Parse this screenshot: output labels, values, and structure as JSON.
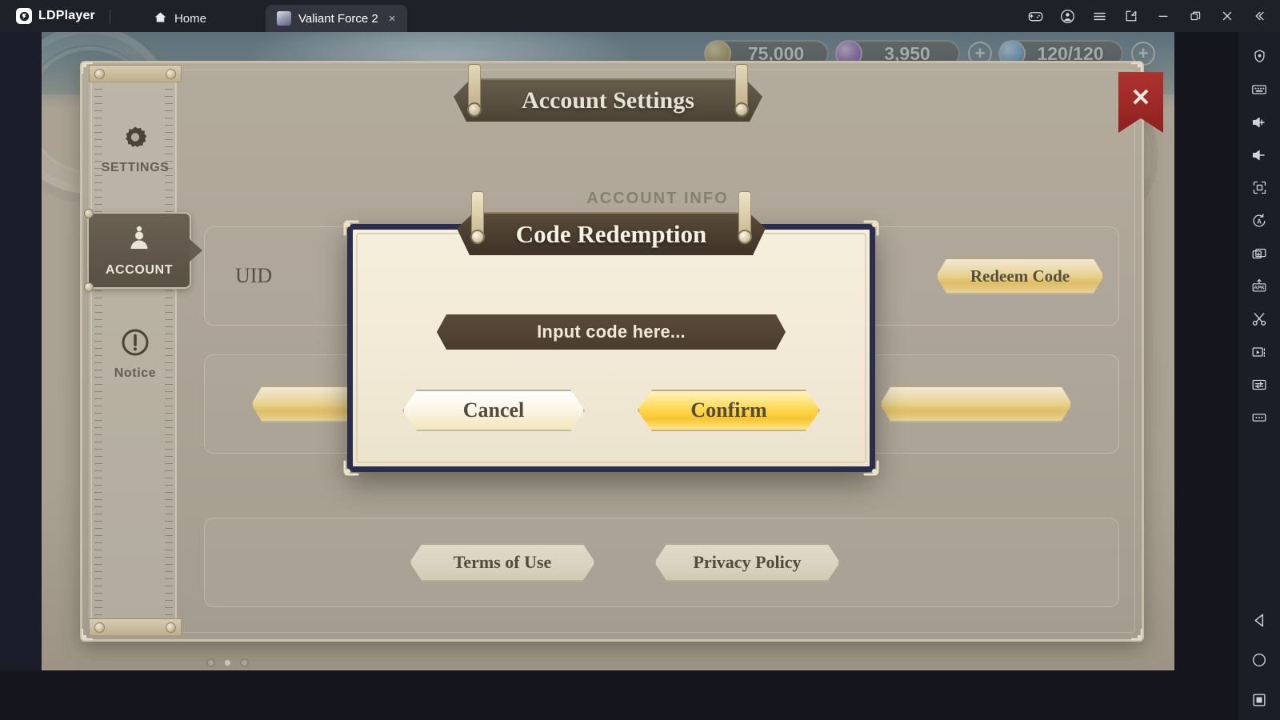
{
  "titlebar": {
    "brand": "LDPlayer",
    "brand_mark": "logo-icon",
    "tabs": [
      {
        "label": "Home",
        "icon": "home-icon",
        "active": false,
        "closable": false
      },
      {
        "label": "Valiant Force 2",
        "icon": "app-favicon",
        "active": true,
        "closable": true,
        "close": "×"
      }
    ],
    "controls": [
      {
        "name": "gamepad-icon",
        "title": "Gamepad"
      },
      {
        "name": "account-icon",
        "title": "Account"
      },
      {
        "name": "menu-icon",
        "title": "Menu"
      },
      {
        "name": "new-window-icon",
        "title": "New Window"
      },
      {
        "name": "minimize-icon",
        "title": "Minimize"
      },
      {
        "name": "maximize-icon",
        "title": "Maximize"
      },
      {
        "name": "close-icon",
        "title": "Close"
      },
      {
        "name": "collapse-icon",
        "title": "Collapse"
      }
    ]
  },
  "rail": {
    "tools": [
      {
        "name": "operation-record-icon"
      },
      {
        "name": "keyboard-mapping-icon"
      },
      {
        "name": "volume-up-icon"
      },
      {
        "name": "volume-down-icon"
      },
      {
        "name": "fullscreen-icon"
      },
      {
        "name": "auto-rotate-icon"
      },
      {
        "name": "multi-instance-icon"
      },
      {
        "name": "install-apk-icon"
      },
      {
        "name": "scissors-icon"
      },
      {
        "name": "video-record-icon"
      },
      {
        "name": "sync-operation-icon"
      },
      {
        "name": "more-icon"
      }
    ],
    "nav": [
      {
        "name": "back-icon"
      },
      {
        "name": "home-circle-icon"
      },
      {
        "name": "recent-apps-icon"
      }
    ]
  },
  "game": {
    "resources": [
      {
        "name": "gold",
        "icon": "gold-coin-icon",
        "value": "75,000",
        "plus": false
      },
      {
        "name": "gems",
        "icon": "gem-icon",
        "value": "3,950",
        "plus": true,
        "plus_label": "+"
      },
      {
        "name": "stamina",
        "icon": "stamina-potion-icon",
        "value": "120/120",
        "plus": true,
        "plus_label": "+"
      }
    ],
    "header_title": "Account Settings",
    "close_label": "✕",
    "side_tabs": [
      {
        "id": "settings",
        "label": "SETTINGS",
        "icon": "gear-icon",
        "active": false
      },
      {
        "id": "account",
        "label": "ACCOUNT",
        "icon": "person-icon",
        "active": true
      },
      {
        "id": "notice",
        "label": "Notice",
        "icon": "exclamation-circle-icon",
        "active": false
      }
    ],
    "section_title": "ACCOUNT INFO",
    "uid_label": "UID",
    "uid_value": "",
    "redeem_button": "Redeem Code",
    "mid_buttons": [
      {
        "label": ""
      },
      {
        "label": ""
      }
    ],
    "legal_buttons": [
      {
        "label": "Terms of Use"
      },
      {
        "label": "Privacy Policy"
      }
    ],
    "page_dots": [
      {
        "active": false
      },
      {
        "active": true
      },
      {
        "active": false
      }
    ]
  },
  "modal": {
    "title": "Code Redemption",
    "input_placeholder": "Input code here...",
    "input_value": "",
    "cancel_label": "Cancel",
    "confirm_label": "Confirm"
  },
  "colors": {
    "titlebar_bg": "#1f2129",
    "tab_active_bg": "#33353f",
    "rail_bg": "#1c1e27",
    "panel_bg": "#b6ada0",
    "modal_bg": "#f2ead6",
    "modal_border": "#2a2e4c",
    "plaque_brown": "#4a3d2f",
    "gold_accent": "#ffd851",
    "close_red": "#b53331"
  }
}
